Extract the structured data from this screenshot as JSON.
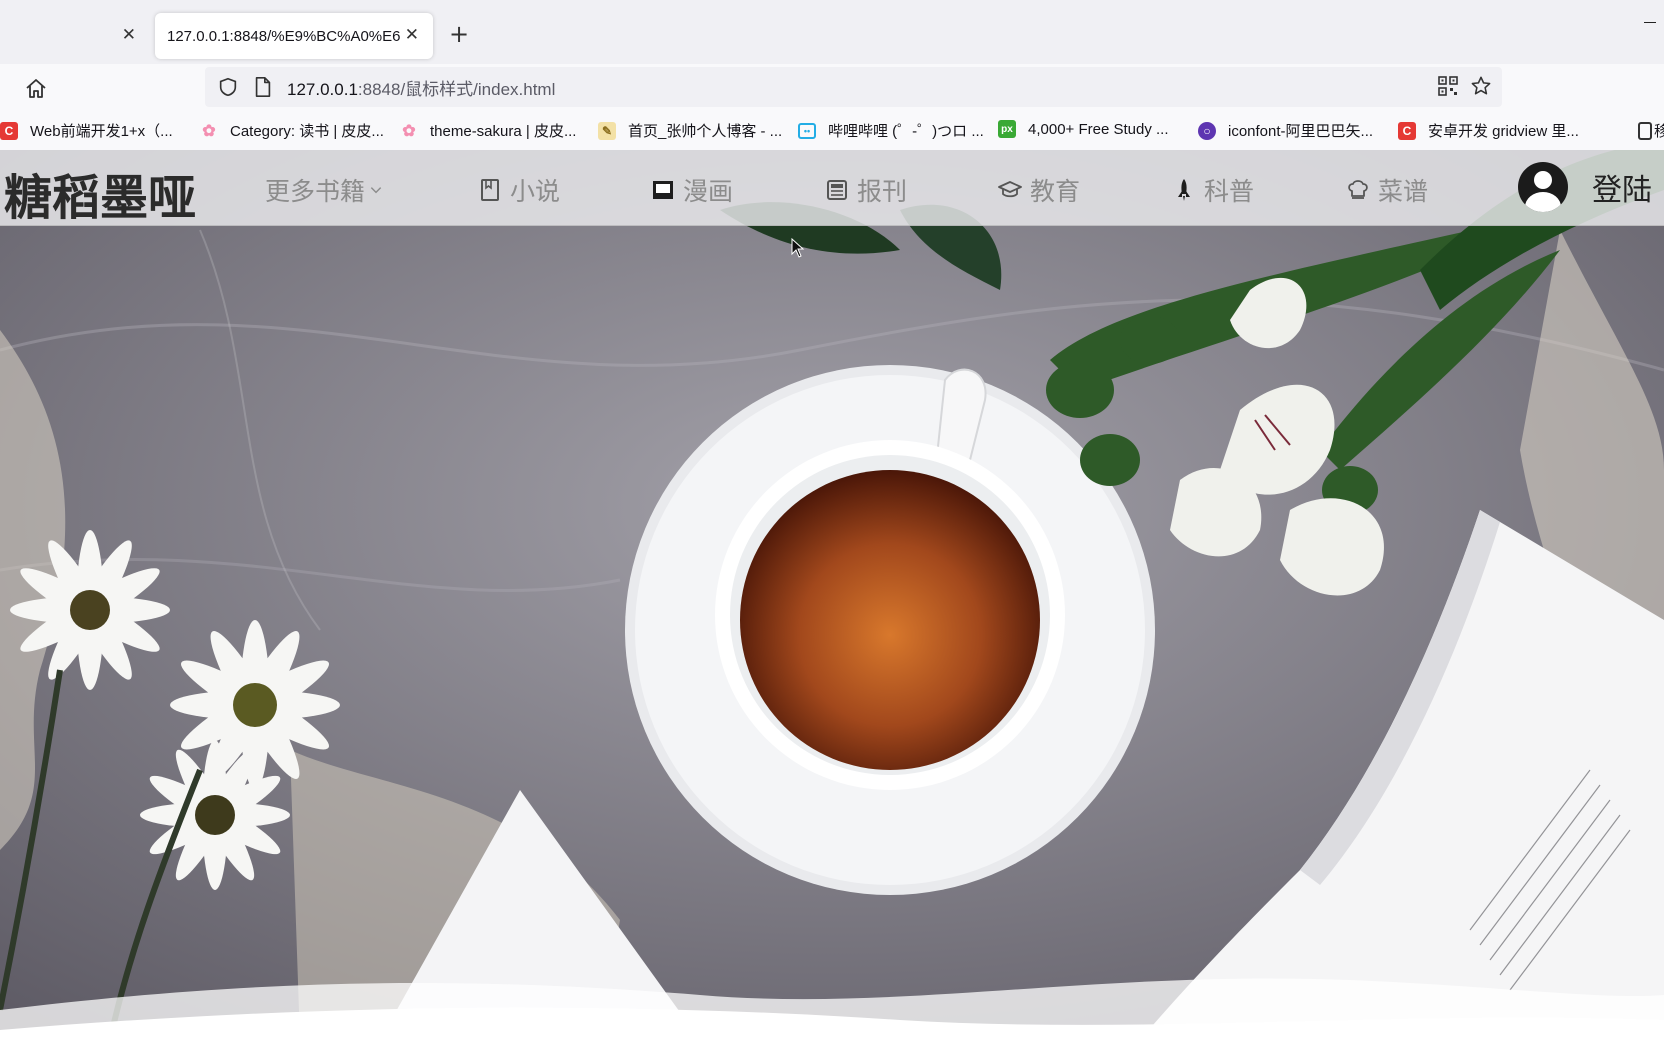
{
  "browser": {
    "tabs": [
      {
        "title": "",
        "active": false
      },
      {
        "title": "127.0.0.1:8848/%E9%BC%A0%E6",
        "active": true
      }
    ],
    "url_host": "127.0.0.1",
    "url_rest": ":8848/鼠标样式/index.html",
    "bookmarks": [
      {
        "label": "Web前端开发1+x（...",
        "icon": "c-red-icon",
        "color": "#e53935"
      },
      {
        "label": "Category: 读书 | 皮皮...",
        "icon": "sakura-icon",
        "color": "#f48fb1"
      },
      {
        "label": "theme-sakura | 皮皮...",
        "icon": "sakura-icon",
        "color": "#f48fb1"
      },
      {
        "label": "首页_张帅个人博客 - ...",
        "icon": "blog-icon",
        "color": "#d4a017"
      },
      {
        "label": "哔哩哔哩 (゜-゜)つロ ...",
        "icon": "bilibili-icon",
        "color": "#23ade5"
      },
      {
        "label": "4,000+ Free Study ...",
        "icon": "px-icon",
        "color": "#3aa935"
      },
      {
        "label": "iconfont-阿里巴巴矢...",
        "icon": "iconfont-icon",
        "color": "#5e35b1"
      },
      {
        "label": "安卓开发 gridview 里...",
        "icon": "c-red-icon",
        "color": "#e53935"
      },
      {
        "label": "移",
        "icon": "folder-icon",
        "color": "#333333"
      }
    ]
  },
  "site": {
    "logo": "糖稻墨哑",
    "nav": [
      {
        "label": "更多书籍",
        "icon": "chevron-down-icon"
      },
      {
        "label": "小说",
        "icon": "book-icon"
      },
      {
        "label": "漫画",
        "icon": "comic-icon"
      },
      {
        "label": "报刊",
        "icon": "newspaper-icon"
      },
      {
        "label": "教育",
        "icon": "graduation-cap-icon"
      },
      {
        "label": "科普",
        "icon": "rocket-icon"
      },
      {
        "label": "菜谱",
        "icon": "chef-hat-icon"
      }
    ],
    "login_label": "登陆",
    "hero_image": "tea-cup-flowers-photo"
  }
}
